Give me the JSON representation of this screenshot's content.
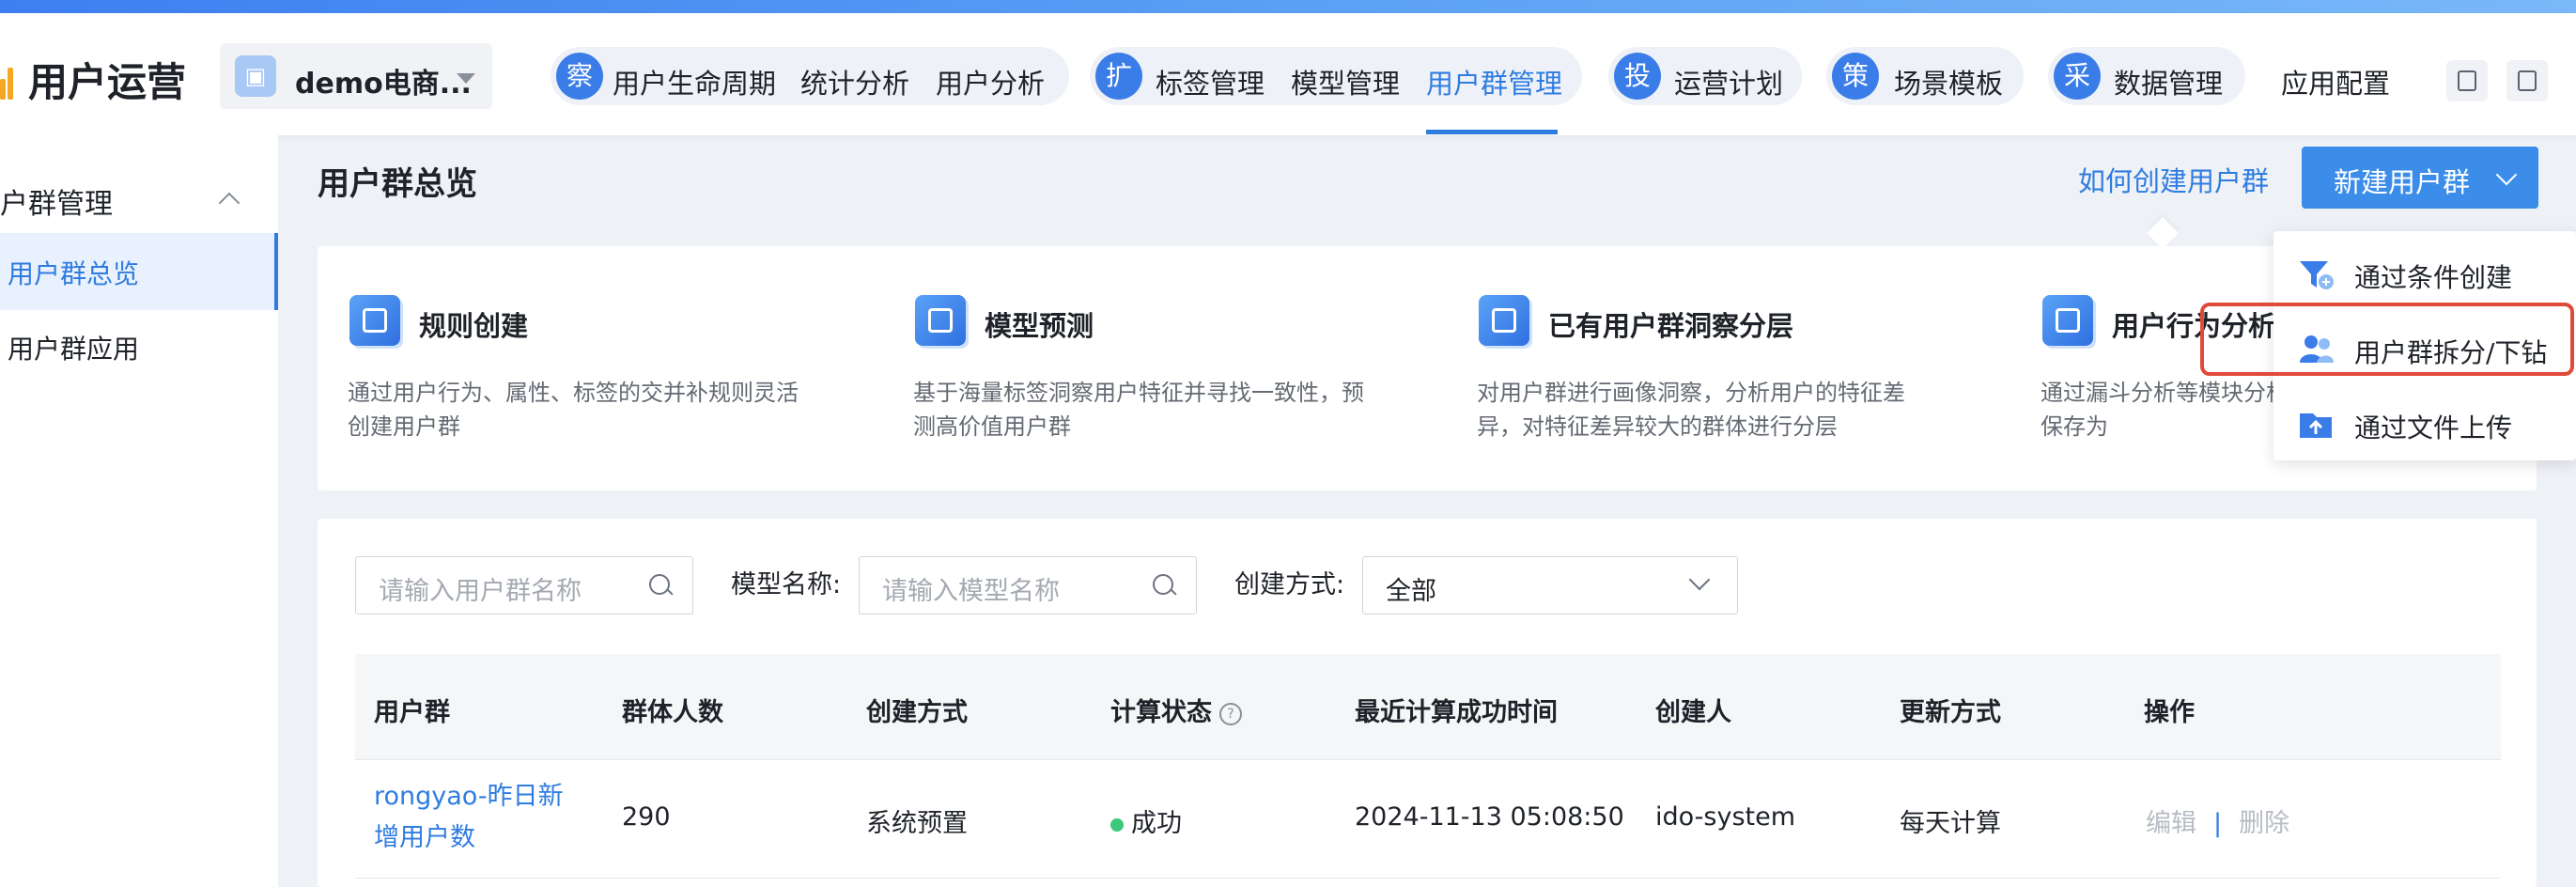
{
  "header": {
    "app_title": "用户运营",
    "project_name": "demo电商...",
    "nav_groups": [
      {
        "badge": "察",
        "links": [
          "用户生命周期",
          "统计分析",
          "用户分析"
        ]
      },
      {
        "badge": "扩",
        "links": [
          "标签管理",
          "模型管理",
          "用户群管理"
        ]
      },
      {
        "badge": "投",
        "links": [
          "运营计划"
        ]
      },
      {
        "badge": "策",
        "links": [
          "场景模板"
        ]
      },
      {
        "badge": "采",
        "links": [
          "数据管理"
        ]
      }
    ],
    "active_link": "用户群管理",
    "app_config": "应用配置",
    "accent_color": "#2f7ce0"
  },
  "sidebar": {
    "group_label": "户群管理",
    "items": [
      {
        "label": "用户群总览",
        "active": true
      },
      {
        "label": "用户群应用",
        "active": false
      }
    ]
  },
  "page": {
    "title": "用户群总览",
    "how_link": "如何创建用户群",
    "new_button": "新建用户群"
  },
  "cards": [
    {
      "icon": "rule-list-icon",
      "title": "规则创建",
      "desc": "通过用户行为、属性、标签的交并补规则灵活创建用户群"
    },
    {
      "icon": "model-predict-icon",
      "title": "模型预测",
      "desc": "基于海量标签洞察用户特征并寻找一致性，预测高价值用户群"
    },
    {
      "icon": "insight-layer-icon",
      "title": "已有用户群洞察分层",
      "desc": "对用户群进行画像洞察，分析用户的特征差异，对特征差异较大的群体进行分层"
    },
    {
      "icon": "behavior-analysis-icon",
      "title": "用户行为分析",
      "desc": "通过漏斗分析等模块分析，有固定行为特征的保存为"
    }
  ],
  "filters": {
    "group_search_placeholder": "请输入用户群名称",
    "model_label": "模型名称:",
    "model_search_placeholder": "请输入模型名称",
    "method_label": "创建方式:",
    "method_value": "全部"
  },
  "table": {
    "columns": [
      "用户群",
      "群体人数",
      "创建方式",
      "计算状态",
      "最近计算成功时间",
      "创建人",
      "更新方式",
      "操作"
    ],
    "help_mark": "?",
    "rows": [
      {
        "name": "rongyao-昨日新增用户数",
        "count": "290",
        "method": "系统预置",
        "status": "成功",
        "last_success": "2024-11-13 05:08:50",
        "creator": "ido-system",
        "update": "每天计算",
        "op_edit": "编辑",
        "op_sep": "|",
        "op_delete": "删除"
      }
    ]
  },
  "dropdown": {
    "items": [
      {
        "label": "通过条件创建",
        "icon": "funnel-plus-icon"
      },
      {
        "label": "用户群拆分/下钻",
        "icon": "users-split-icon",
        "highlighted": true
      },
      {
        "label": "通过文件上传",
        "icon": "folder-upload-icon"
      }
    ],
    "highlight_color": "#e04a3a"
  }
}
